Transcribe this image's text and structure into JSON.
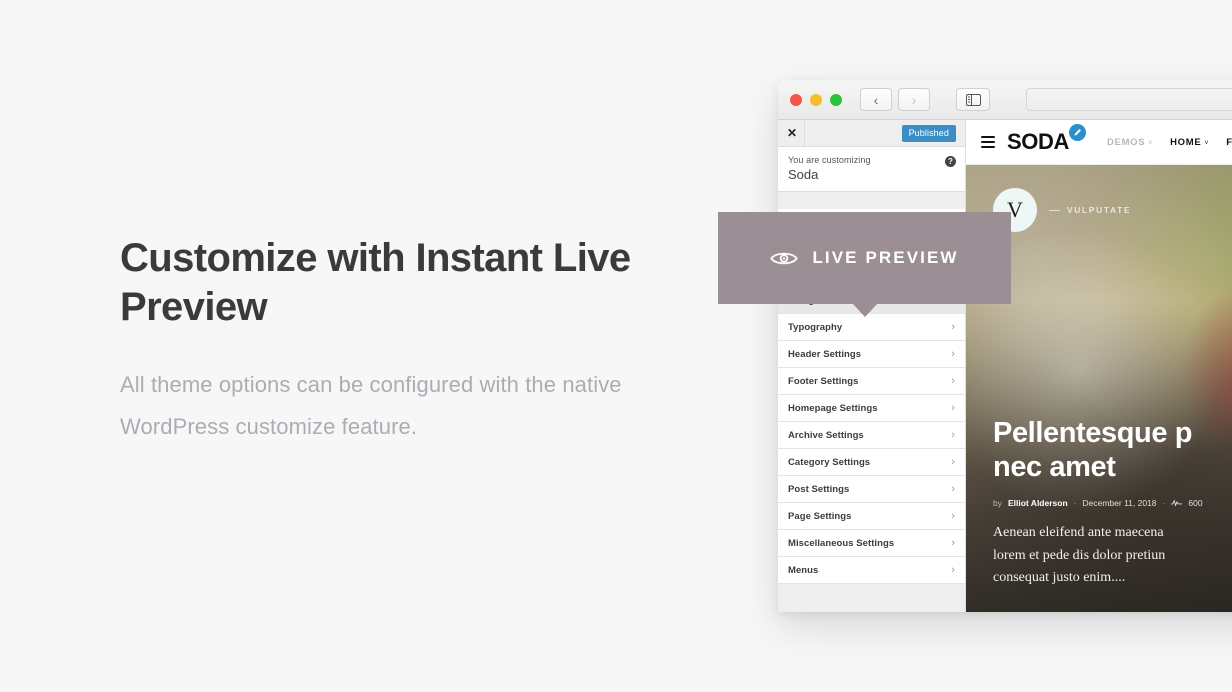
{
  "section": {
    "headline": "Customize with Instant Live Preview",
    "subcopy": "All theme options can be configured with the native WordPress customize feature."
  },
  "live_badge": {
    "label": "LIVE PREVIEW",
    "icon": "eye-icon",
    "color": "#9b8f95"
  },
  "browser": {
    "traffic_lights": [
      {
        "name": "close",
        "color": "#f5564c"
      },
      {
        "name": "minimize",
        "color": "#f7bd2e"
      },
      {
        "name": "maximize",
        "color": "#29c33d"
      }
    ],
    "back_label": "‹",
    "forward_label": "›",
    "sidebar_icon": "sidebar-toggle-icon",
    "url_value": "",
    "url_placeholder": ""
  },
  "customizer": {
    "close_label": "✕",
    "publish_label": "Published",
    "publish_color": "#3c8dc5",
    "customizing_label": "You are customizing",
    "site_title": "Soda",
    "help_label": "?",
    "items": [
      {
        "label": "Design",
        "active": true
      },
      {
        "label": "Typography",
        "active": false
      },
      {
        "label": "Header Settings",
        "active": false
      },
      {
        "label": "Footer Settings",
        "active": false
      },
      {
        "label": "Homepage Settings",
        "active": false
      },
      {
        "label": "Archive Settings",
        "active": false
      },
      {
        "label": "Category Settings",
        "active": false
      },
      {
        "label": "Post Settings",
        "active": false
      },
      {
        "label": "Page Settings",
        "active": false
      },
      {
        "label": "Miscellaneous Settings",
        "active": false
      },
      {
        "label": "Menus",
        "active": false
      }
    ],
    "chevron": "›"
  },
  "site": {
    "logo": "SODA",
    "logo_badge_icon": "pencil-icon",
    "menu_icon": "hamburger-icon",
    "nav": [
      {
        "label": "DEMOS",
        "muted": true,
        "caret": "˅"
      },
      {
        "label": "HOME",
        "muted": false,
        "caret": "˅"
      },
      {
        "label": "F",
        "muted": false,
        "caret": ""
      }
    ],
    "hero": {
      "avatar_letter": "V",
      "category": "VULPUTATE",
      "title_line1": "Pellentesque p",
      "title_line2": "nec amet",
      "byline_by": "by",
      "byline_author": "Elliot Alderson",
      "byline_date": "December 11, 2018",
      "byline_views": "600",
      "excerpt_line1": "Aenean eleifend ante maecena",
      "excerpt_line2": "lorem et pede dis dolor pretiun",
      "excerpt_line3": "consequat justo enim...."
    }
  }
}
